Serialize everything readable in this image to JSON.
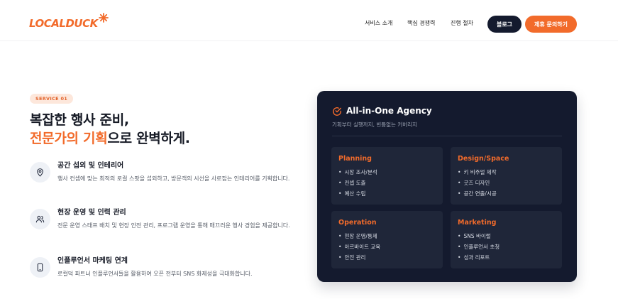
{
  "header": {
    "logo_text": "LOCALDUCK",
    "nav": [
      "서비스 소개",
      "핵심 경쟁력",
      "진행 절차"
    ],
    "blog_label": "블로그",
    "contact_label": "제휴 문의하기"
  },
  "service": {
    "badge": "SERVICE 01",
    "title_line1": "복잡한 행사 준비,",
    "title_highlight": "전문가의 기획",
    "title_rest": "으로 완벽하게.",
    "features": [
      {
        "icon": "location-pin-icon",
        "title": "공간 섭외 및 인테리어",
        "desc": "행사 컨셉에 맞는 최적의 로컬 스팟을 섭외하고, 방문객의 시선을 사로잡는 인테리어를 기획합니다."
      },
      {
        "icon": "users-icon",
        "title": "현장 운영 및 인력 관리",
        "desc": "전문 운영 스태프 배치 및 현장 안전 관리, 프로그램 운영을 통해 매끄러운 행사 경험을 제공합니다."
      },
      {
        "icon": "smartphone-icon",
        "title": "인플루언서 마케팅 연계",
        "desc": "로컬덕 파트너 인플루언서들을 활용하여 오픈 전부터 SNS 화제성을 극대화합니다."
      }
    ]
  },
  "agency_card": {
    "icon": "check-circle-icon",
    "title": "All-in-One Agency",
    "subtitle": "기획부터 실행까지, 빈틈없는 커버리지",
    "cells": [
      {
        "title": "Planning",
        "items": [
          "시장 조사/분석",
          "컨셉 도출",
          "예산 수립"
        ]
      },
      {
        "title": "Design/Space",
        "items": [
          "키 비주얼 제작",
          "굿즈 디자인",
          "공간 연출/시공"
        ]
      },
      {
        "title": "Operation",
        "items": [
          "현장 운영/통제",
          "아르바이트 교육",
          "안전 관리"
        ]
      },
      {
        "title": "Marketing",
        "items": [
          "SNS 바이럴",
          "인플루언서 초청",
          "성과 리포트"
        ]
      }
    ]
  },
  "colors": {
    "accent": "#f26b2b",
    "navy": "#141a2e",
    "cell_bg": "#1f2639",
    "badge_bg": "#fde7db"
  }
}
